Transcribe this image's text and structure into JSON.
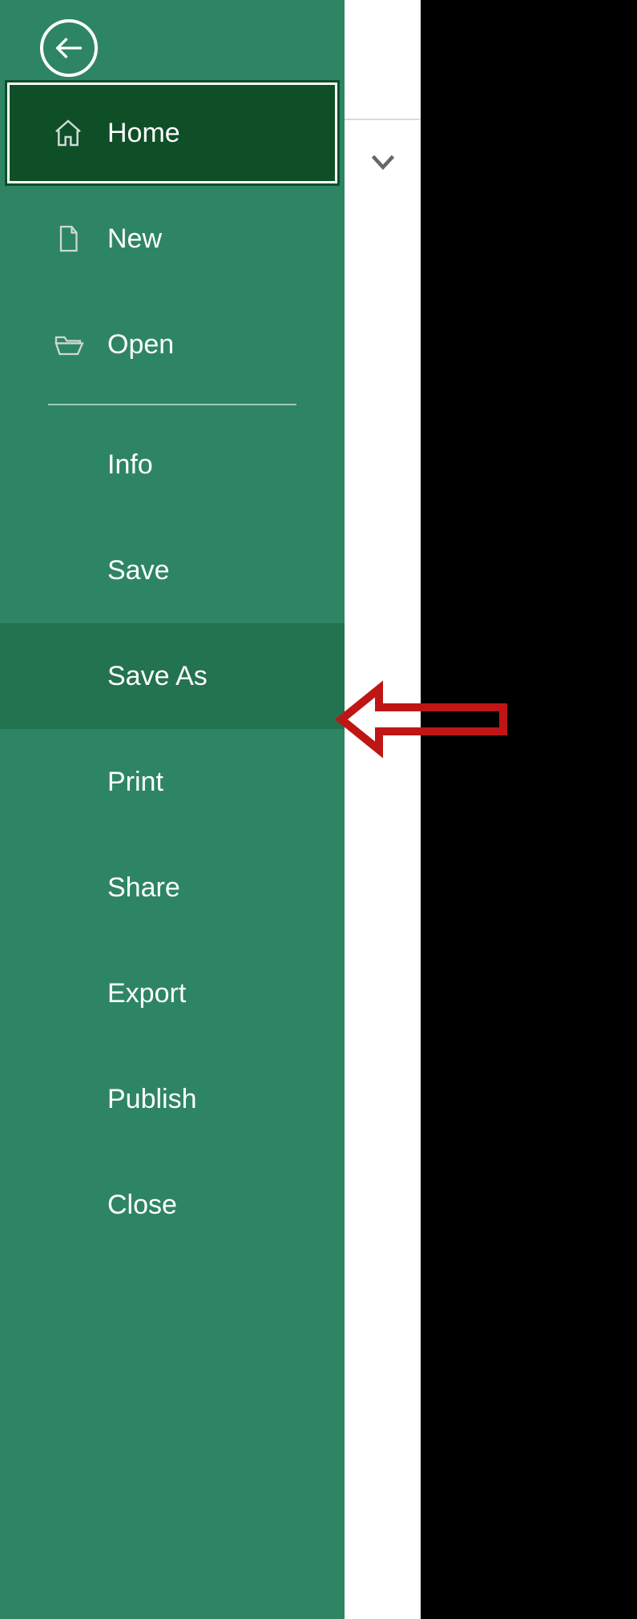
{
  "colors": {
    "panel": "#2e8563",
    "selected": "#0e4f28",
    "hover": "#237250",
    "arrow": "#bf1515"
  },
  "backstage": {
    "back_button": "Back",
    "selected": "Home",
    "highlighted": "Save As",
    "items": [
      {
        "id": "home",
        "label": "Home",
        "icon": "home-icon",
        "state": "selected"
      },
      {
        "id": "new",
        "label": "New",
        "icon": "file-icon",
        "state": "normal"
      },
      {
        "id": "open",
        "label": "Open",
        "icon": "folder-icon",
        "state": "normal"
      },
      {
        "id": "info",
        "label": "Info",
        "icon": null,
        "state": "normal"
      },
      {
        "id": "save",
        "label": "Save",
        "icon": null,
        "state": "normal"
      },
      {
        "id": "saveas",
        "label": "Save As",
        "icon": null,
        "state": "hover"
      },
      {
        "id": "print",
        "label": "Print",
        "icon": null,
        "state": "normal"
      },
      {
        "id": "share",
        "label": "Share",
        "icon": null,
        "state": "normal"
      },
      {
        "id": "export",
        "label": "Export",
        "icon": null,
        "state": "normal"
      },
      {
        "id": "publish",
        "label": "Publish",
        "icon": null,
        "state": "normal"
      },
      {
        "id": "close",
        "label": "Close",
        "icon": null,
        "state": "normal"
      }
    ]
  },
  "annotation": {
    "type": "arrow-left",
    "target": "Save As"
  }
}
